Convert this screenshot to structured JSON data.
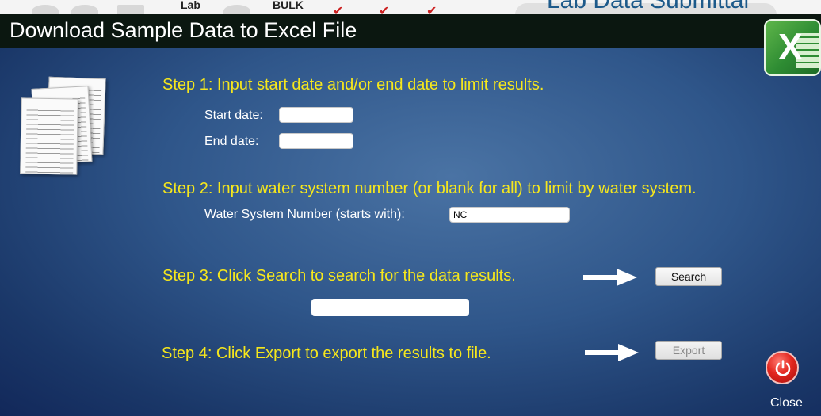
{
  "underlay": {
    "items": [
      "Lab",
      "BULK"
    ],
    "title": "Lab Data Submittal"
  },
  "dialog": {
    "title": "Download Sample Data to Excel File",
    "close_label": "Close"
  },
  "step1": {
    "text": "Step 1: Input start date and/or end date to limit results.",
    "start_label": "Start date:",
    "start_value": "",
    "end_label": "End date:",
    "end_value": ""
  },
  "step2": {
    "text": "Step 2: Input water system number (or blank for all) to limit by water system.",
    "ws_label": "Water System Number (starts with):",
    "ws_value": "NC"
  },
  "step3": {
    "text": "Step 3: Click Search to search for the data results.",
    "search_label": "Search",
    "status_value": ""
  },
  "step4": {
    "text": "Step 4: Click Export to export the results to file.",
    "export_label": "Export"
  },
  "colors": {
    "header_bg": "#0b1710",
    "step_text": "#f6e71c",
    "body_gradient_center": "#4a73a4",
    "body_gradient_edge": "#12285a",
    "close_red": "#e3271f"
  },
  "icons": [
    "excel-icon",
    "documents-icon",
    "arrow-right-icon",
    "power-icon"
  ]
}
